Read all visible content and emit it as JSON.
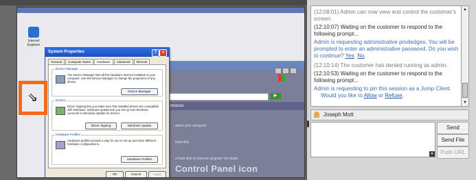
{
  "remote": {
    "desktop_icon_label": "Internet Explorer",
    "cpanel_strip": "Performance",
    "cpanel_texts": [
      "about your computer",
      "hard disk",
      "a hard disk to improve program run faster"
    ],
    "cpanel_big": "Control Panel icon"
  },
  "dialog": {
    "title": "System Properties",
    "tabs": [
      "General",
      "Computer Name",
      "Hardware",
      "Advanced",
      "Remote"
    ],
    "active_tab": "Hardware",
    "groups": [
      {
        "title": "Device Manager",
        "text": "The Device Manager lists all the hardware devices installed on your computer. Use the Device Manager to change the properties of any device.",
        "buttons": [
          "Device Manager"
        ]
      },
      {
        "title": "Drivers",
        "text": "Driver Signing lets you make sure that installed drivers are compatible with Windows. Windows Update lets you set up how Windows connects to Windows Update for drivers.",
        "buttons": [
          "Driver Signing",
          "Windows Update"
        ]
      },
      {
        "title": "Hardware Profiles",
        "text": "Hardware profiles provide a way for you to set up and store different hardware configurations.",
        "buttons": [
          "Hardware Profiles"
        ]
      }
    ],
    "footer_buttons": [
      "OK",
      "Cancel",
      "Apply"
    ]
  },
  "chat": {
    "lines": [
      {
        "time": "(12:08:01)",
        "text": "Admin can now view and control the customer's screen.",
        "style": "gray"
      },
      {
        "time": "(12:10:07)",
        "text": "Waiting on the customer to respond to the following prompt...",
        "style": "dark"
      },
      {
        "time": "",
        "text": "Admin is requesting administrative priviledges. You will be prompted to enter an administrative password. Do you wish to continue?",
        "style": "blue"
      },
      {
        "time": "(12:10:14)",
        "text": "The customer has denied running as admin.",
        "style": "gray"
      },
      {
        "time": "(12:10:53)",
        "text": "Waiting on the customer to respond to the following prompt...",
        "style": "dark"
      },
      {
        "time": "",
        "text": "Admin is requesting to pin this session as a Jump Client.",
        "style": "blue"
      },
      {
        "time": "",
        "text": "Would you like to",
        "style": "blue"
      }
    ],
    "link_yes": "Yes",
    "link_no": "No",
    "link_allow": "Allow",
    "link_or": "or",
    "link_refuse": "Refuse"
  },
  "participant": {
    "name": "Joseph Mott"
  },
  "actions": {
    "send": "Send",
    "send_file": "Send File",
    "push_url": "Push URL"
  }
}
